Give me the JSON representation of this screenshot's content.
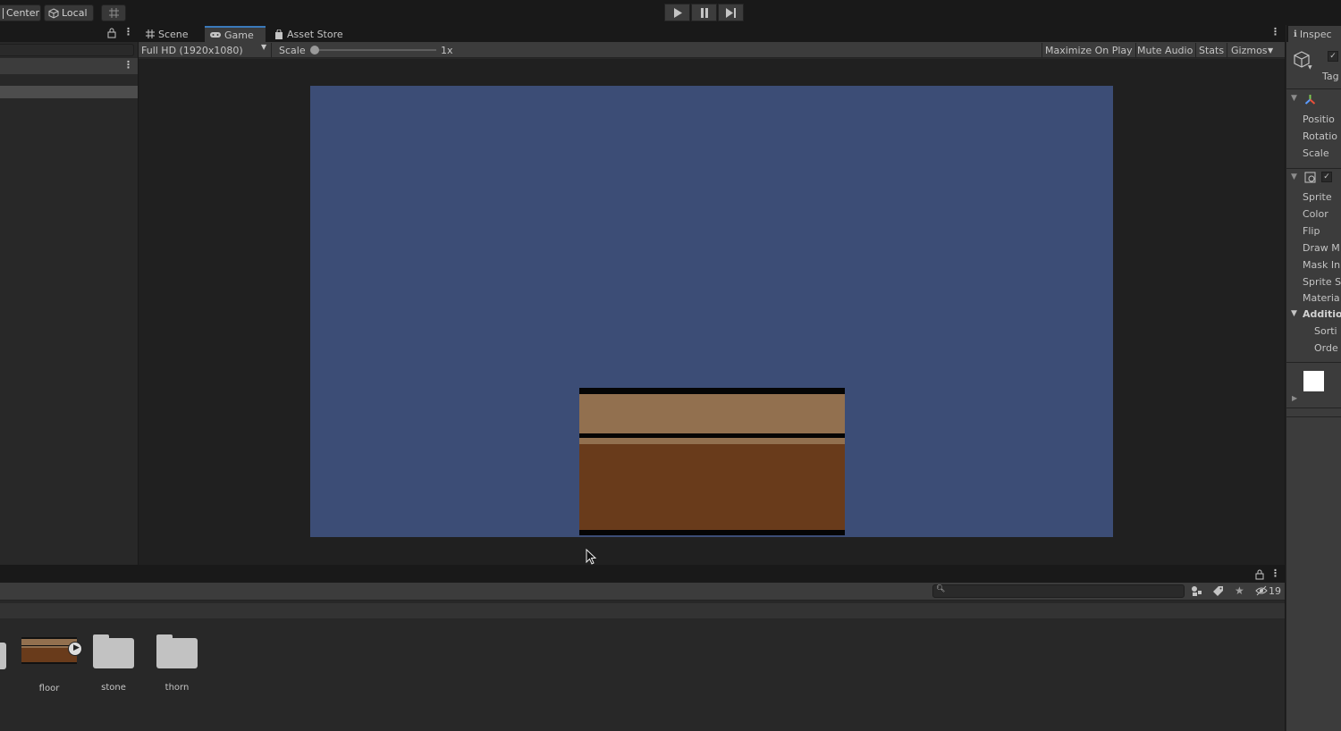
{
  "toolbar": {
    "pivot_label": "Center",
    "space_label": "Local"
  },
  "game_tabs": [
    "Scene",
    "Game",
    "Asset Store"
  ],
  "game_toolbar": {
    "resolution": "Full HD (1920x1080)",
    "scale_label": "Scale",
    "scale_value": "1x",
    "maximize": "Maximize On Play",
    "mute": "Mute Audio",
    "stats": "Stats",
    "gizmos": "Gizmos"
  },
  "inspector": {
    "tab": "Inspec",
    "tag_label": "Tag",
    "transform_props": [
      "Positio",
      "Rotatio",
      "Scale"
    ],
    "sprite_props": [
      "Sprite",
      "Color",
      "Flip",
      "Draw M",
      "Mask In",
      "Sprite S",
      "Materia"
    ],
    "additional": "Additio",
    "additional_props": [
      "Sorti",
      "Orde"
    ]
  },
  "project": {
    "hidden_count": "19",
    "assets": [
      {
        "name": "floor",
        "type": "prefab"
      },
      {
        "name": "stone",
        "type": "folder"
      },
      {
        "name": "thorn",
        "type": "folder"
      }
    ]
  },
  "colors": {
    "sky": "#3c4d76",
    "floor_light": "#92704f",
    "floor_dark": "#693b1b",
    "accent": "#3a79bb"
  }
}
